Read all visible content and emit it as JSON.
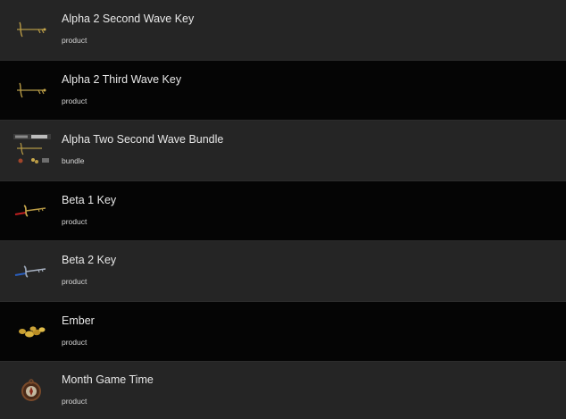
{
  "items": [
    {
      "title": "Alpha 2 Second Wave Key",
      "type": "product",
      "icon": "golden-key-icon"
    },
    {
      "title": "Alpha 2 Third Wave Key",
      "type": "product",
      "icon": "golden-key-icon"
    },
    {
      "title": "Alpha Two Second Wave Bundle",
      "type": "bundle",
      "icon": "bundle-items-icon"
    },
    {
      "title": "Beta 1 Key",
      "type": "product",
      "icon": "red-gold-key-icon"
    },
    {
      "title": "Beta 2 Key",
      "type": "product",
      "icon": "blue-silver-key-icon"
    },
    {
      "title": "Ember",
      "type": "product",
      "icon": "gold-coins-icon"
    },
    {
      "title": "Month Game Time",
      "type": "product",
      "icon": "compass-icon"
    }
  ],
  "colors": {
    "row_light": "#252525",
    "row_dark": "#050505",
    "title_text": "#e8e8e8",
    "gold": "#b89a45"
  }
}
